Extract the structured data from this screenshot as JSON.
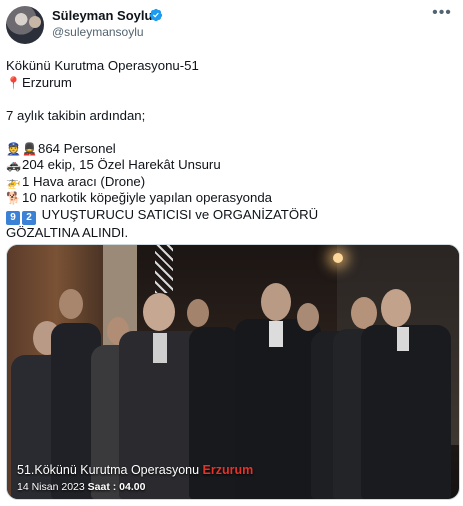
{
  "user": {
    "display_name": "Süleyman Soylu",
    "handle": "@suleymansoylu",
    "verified": true,
    "avatar_icon": "profile-photo",
    "more_icon": "more-horizontal-icon"
  },
  "tweet": {
    "lines": [
      {
        "icon": "",
        "text": "Kökünü Kurutma Operasyonu-51"
      },
      {
        "icon": "round-pushpin-icon",
        "text": "Erzurum"
      },
      {
        "icon": "",
        "text": ""
      },
      {
        "icon": "",
        "text": "7 aylık takibin ardından;"
      },
      {
        "icon": "",
        "text": ""
      },
      {
        "icon": "police-officer-icons",
        "text": "864 Personel"
      },
      {
        "icon": "police-car-icon",
        "text": "204 ekip, 15 Özel Harekât Unsuru"
      },
      {
        "icon": "helicopter-icon",
        "text": "1 Hava aracı (Drone)"
      },
      {
        "icon": "dog-icon",
        "text": "10 narkotik köpeğiyle yapılan operasyonda"
      },
      {
        "icon": "keycap-92-icon",
        "text": "UYUŞTURUCU SATICISI ve ORGANİZATÖRÜ"
      },
      {
        "icon": "",
        "text": "GÖZALTINA ALINDI."
      }
    ],
    "keycap_digits": [
      "9",
      "2"
    ]
  },
  "media": {
    "caption_title": "51.Kökünü Kurutma Operasyonu",
    "caption_city": "Erzurum",
    "caption_date": "14 Nisan 2023",
    "caption_time": "Saat : 04.00",
    "accent_color": "#e5332a"
  }
}
